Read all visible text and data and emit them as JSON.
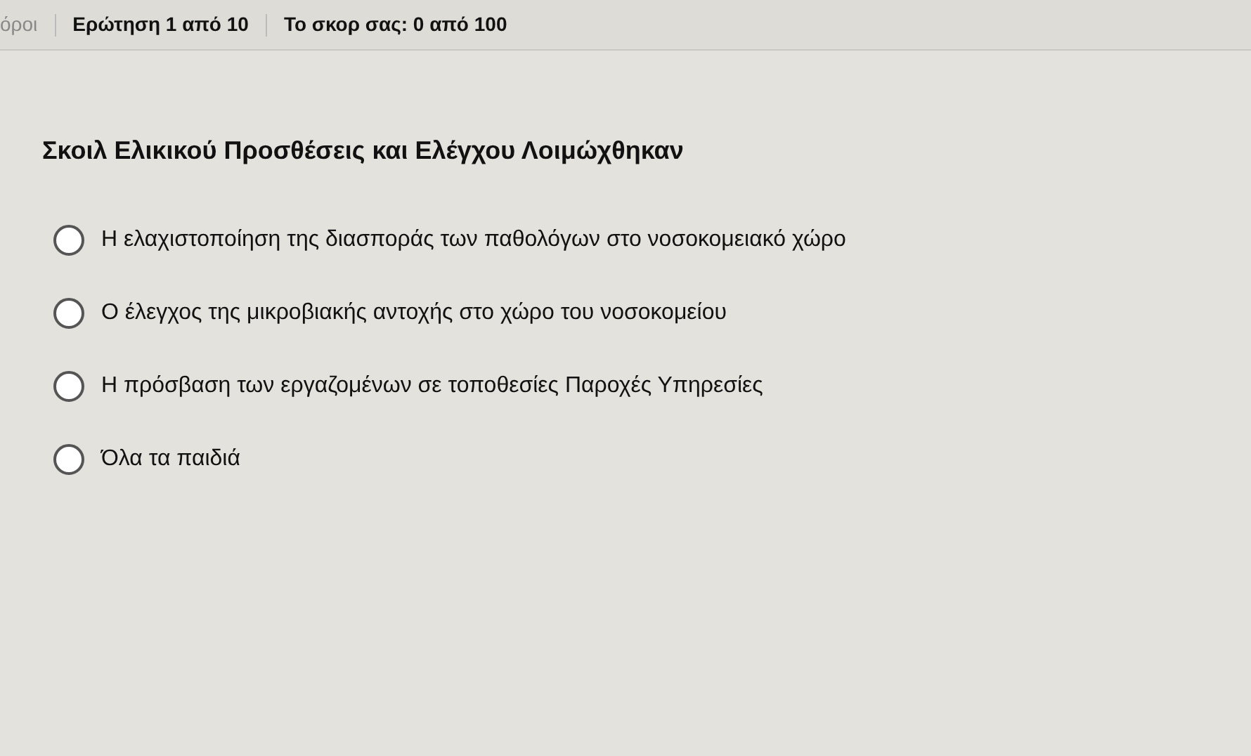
{
  "top_bar": {
    "items": [
      "όροι",
      "Ερώτηση 1 από 10",
      "Το σκορ σας: 0 από 100"
    ]
  },
  "question": {
    "text": "Σκοιλ Ελικικού Προσθέσεις και Ελέγχου Λοιμώχθηκαν",
    "options": [
      {
        "label": "Η ελαχιστοποίηση της διασποράς των παθολόγων στο νοσοκομειακό χώρο",
        "selected": false
      },
      {
        "label": "Ο έλεγχος της μικροβιακής αντοχής στο χώρο του νοσοκομείου",
        "selected": false
      },
      {
        "label": "Η πρόσβαση των εργαζομένων σε τοποθεσίες Παροχές Υπηρεσίες",
        "selected": false
      },
      {
        "label": "Όλα τα παιδιά",
        "selected": false
      }
    ]
  }
}
